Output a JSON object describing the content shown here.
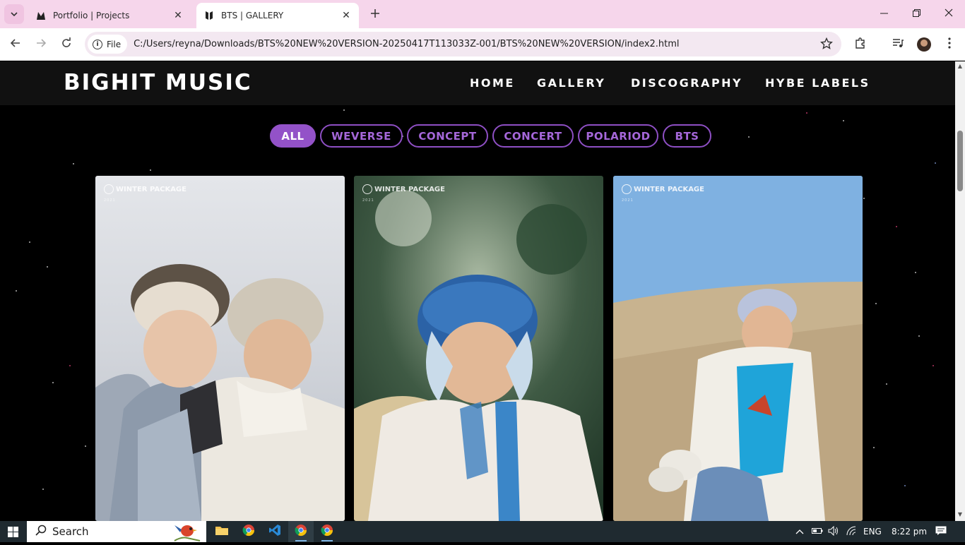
{
  "browser": {
    "tabs": [
      {
        "title": "Portfolio | Projects",
        "active": false
      },
      {
        "title": "BTS | GALLERY",
        "active": true
      }
    ],
    "address": {
      "scheme_label": "File",
      "url": "C:/Users/reyna/Downloads/BTS%20NEW%20VERSION-20250417T113033Z-001/BTS%20NEW%20VERSION/index2.html"
    }
  },
  "site": {
    "logo": "BIGHIT MUSIC",
    "nav": [
      "HOME",
      "GALLERY",
      "DISCOGRAPHY",
      "HYBE LABELS"
    ],
    "filters": [
      "ALL",
      "WEVERSE",
      "CONCEPT",
      "CONCERT",
      "POLARIOD",
      "BTS"
    ],
    "active_filter": "ALL",
    "gallery": [
      {
        "watermark": "WINTER PACKAGE",
        "subtitle": "2021"
      },
      {
        "watermark": "WINTER PACKAGE",
        "subtitle": "2021"
      },
      {
        "watermark": "WINTER PACKAGE",
        "subtitle": "2021"
      }
    ]
  },
  "colors": {
    "accent": "#9352c8",
    "header_bg": "#111111",
    "page_bg": "#000000"
  },
  "taskbar": {
    "search_label": "Search",
    "language": "ENG",
    "time": "8:22 pm"
  }
}
